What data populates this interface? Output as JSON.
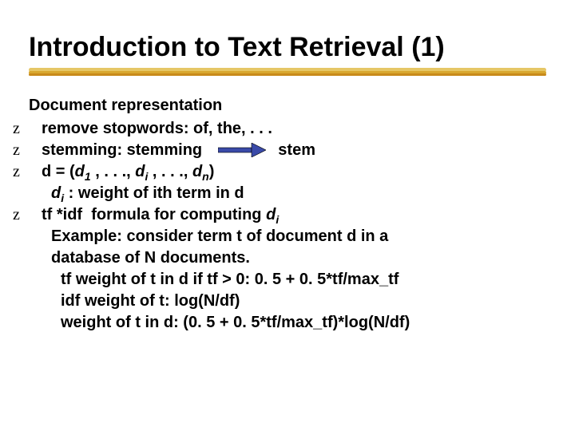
{
  "title": "Introduction to Text Retrieval (1)",
  "bullet_char": "z",
  "section_heading": "Document representation",
  "bullets": {
    "b1": "remove stopwords: of, the, . . .",
    "b2_pre": "stemming: stemming",
    "b2_post": "stem",
    "b3": {
      "line": "d = (d<sub>1</sub> , . . ., d<sub>i</sub> , . . ., d<sub>n</sub>)",
      "desc": "d<sub>i</sub> : weight of ith term in d"
    },
    "b4": {
      "line": "tf *idf  formula for computing d<sub>i</sub>",
      "example_intro": "Example: consider term t of document d in a",
      "example_intro2": "database of N documents.",
      "tf": "tf weight of t in d if tf > 0:   0. 5 + 0. 5*tf/max_tf",
      "idf": "idf weight of t:    log(N/df)",
      "weight": "weight of t in d: (0. 5 + 0. 5*tf/max_tf)*log(N/df)"
    }
  }
}
